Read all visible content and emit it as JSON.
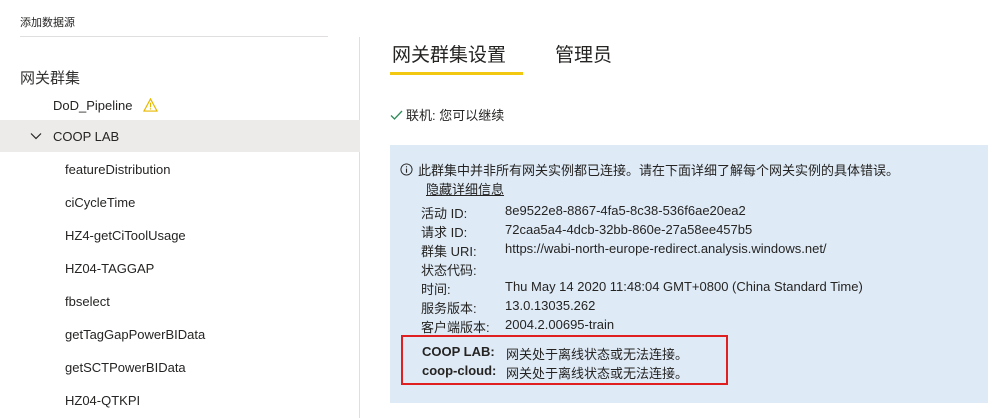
{
  "header": {
    "add_data_source": "添加数据源"
  },
  "sidebar": {
    "group_heading": "网关群集",
    "items": [
      {
        "label": "DoD_Pipeline"
      },
      {
        "label": "COOP LAB"
      },
      {
        "label": "featureDistribution"
      },
      {
        "label": "ciCycleTime"
      },
      {
        "label": "HZ4-getCiToolUsage"
      },
      {
        "label": "HZ04-TAGGAP"
      },
      {
        "label": "fbselect"
      },
      {
        "label": "getTagGapPowerBIData"
      },
      {
        "label": "getSCTPowerBIData"
      },
      {
        "label": "HZ04-QTKPI"
      }
    ]
  },
  "tabs": [
    {
      "label": "网关群集设置"
    },
    {
      "label": "管理员"
    }
  ],
  "status": {
    "text": "联机: 您可以继续"
  },
  "info": {
    "message": "此群集中并非所有网关实例都已连接。请在下面详细了解每个网关实例的具体错误。",
    "hide_details": "隐藏详细信息",
    "details": [
      {
        "key": "活动 ID:",
        "value": "8e9522e8-8867-4fa5-8c38-536f6ae20ea2"
      },
      {
        "key": "请求 ID:",
        "value": "72caa5a4-4dcb-32bb-860e-27a58ee457b5"
      },
      {
        "key": "群集 URI:",
        "value": "https://wabi-north-europe-redirect.analysis.windows.net/"
      },
      {
        "key": "状态代码:",
        "value": ""
      },
      {
        "key": "时间:",
        "value": "Thu May 14 2020 11:48:04 GMT+0800 (China Standard Time)"
      },
      {
        "key": "服务版本:",
        "value": "13.0.13035.262"
      },
      {
        "key": "客户端版本:",
        "value": "2004.2.00695-train"
      }
    ],
    "errors": [
      {
        "key": "COOP LAB:",
        "value": "网关处于离线状态或无法连接。"
      },
      {
        "key": "coop-cloud:",
        "value": "网关处于离线状态或无法连接。"
      }
    ]
  },
  "colors": {
    "accent_underline": "#f2c811",
    "info_background": "#deeaf6",
    "error_border": "#e02020",
    "warning_icon": "#f2c811",
    "success_check": "#2e8b57"
  }
}
